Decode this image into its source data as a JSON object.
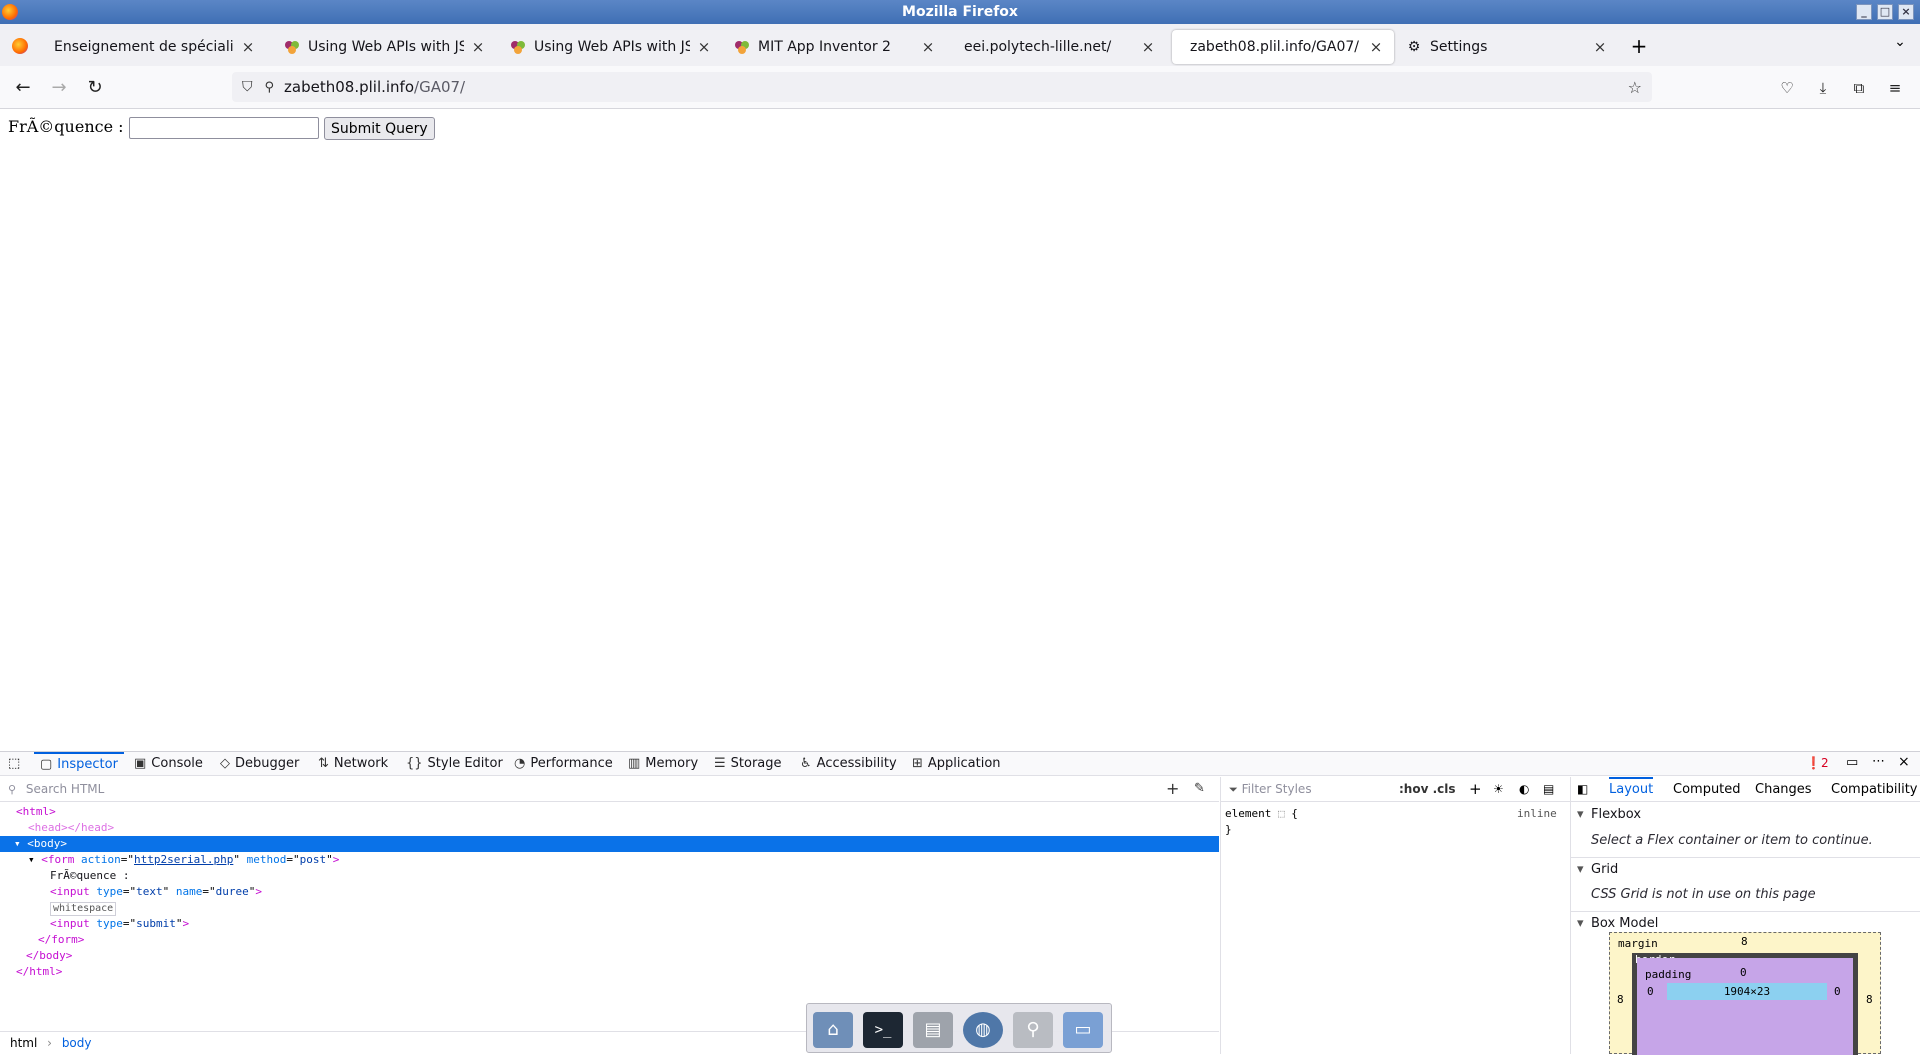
{
  "window": {
    "title": "Mozilla Firefox"
  },
  "tabs": [
    {
      "label": "Enseignement de spécialité",
      "icon": "firefox-icon"
    },
    {
      "label": "Using Web APIs with JSON",
      "icon": "app-inventor-icon"
    },
    {
      "label": "Using Web APIs with JSON",
      "icon": "app-inventor-icon"
    },
    {
      "label": "MIT App Inventor 2",
      "icon": "app-inventor-icon"
    },
    {
      "label": "eei.polytech-lille.net/",
      "icon": ""
    },
    {
      "label": "zabeth08.plil.info/GA07/",
      "icon": ""
    },
    {
      "label": "Settings",
      "icon": "gear-icon"
    }
  ],
  "url": {
    "host": "zabeth08.plil.info",
    "path": "/GA07/"
  },
  "page": {
    "form_label": "FrÃ©quence :",
    "input_value": "",
    "submit_label": "Submit Query"
  },
  "devtools": {
    "tabs": [
      "Inspector",
      "Console",
      "Debugger",
      "Network",
      "Style Editor",
      "Performance",
      "Memory",
      "Storage",
      "Accessibility",
      "Application"
    ],
    "error_count": "2",
    "search_placeholder": "Search HTML",
    "markup": {
      "html_open": "<html>",
      "head": "<head></head>",
      "body_open": "<body>",
      "form_tag": "<form",
      "form_action_attr": "action",
      "form_action_val": "http2serial.php",
      "form_method_attr": "method",
      "form_method_val": "post",
      "text_node": "FrÃ©quence :",
      "input1_tag": "<input",
      "input1_type_attr": "type",
      "input1_type_val": "text",
      "input1_name_attr": "name",
      "input1_name_val": "duree",
      "whitespace": "whitespace",
      "input2_type_val": "submit",
      "form_close": "</form>",
      "body_close": "</body>",
      "html_close": "</html>"
    },
    "breadcrumb": [
      "html",
      "body"
    ],
    "rules": {
      "filter_placeholder": "Filter Styles",
      "pseudo": ":hov .cls",
      "selector": "element",
      "source": "inline",
      "open_brace": "{",
      "close_brace": "}"
    },
    "layout_tabs": [
      "Layout",
      "Computed",
      "Changes",
      "Compatibility"
    ],
    "sections": {
      "flexbox": "Flexbox",
      "flexbox_note": "Select a Flex container or item to continue.",
      "grid": "Grid",
      "grid_note": "CSS Grid is not in use on this page",
      "box_model": "Box Model"
    },
    "box_model": {
      "margin_label": "margin",
      "border_label": "border",
      "padding_label": "padding",
      "content": "1904×23",
      "margin_value": "8",
      "zero": "0"
    }
  }
}
